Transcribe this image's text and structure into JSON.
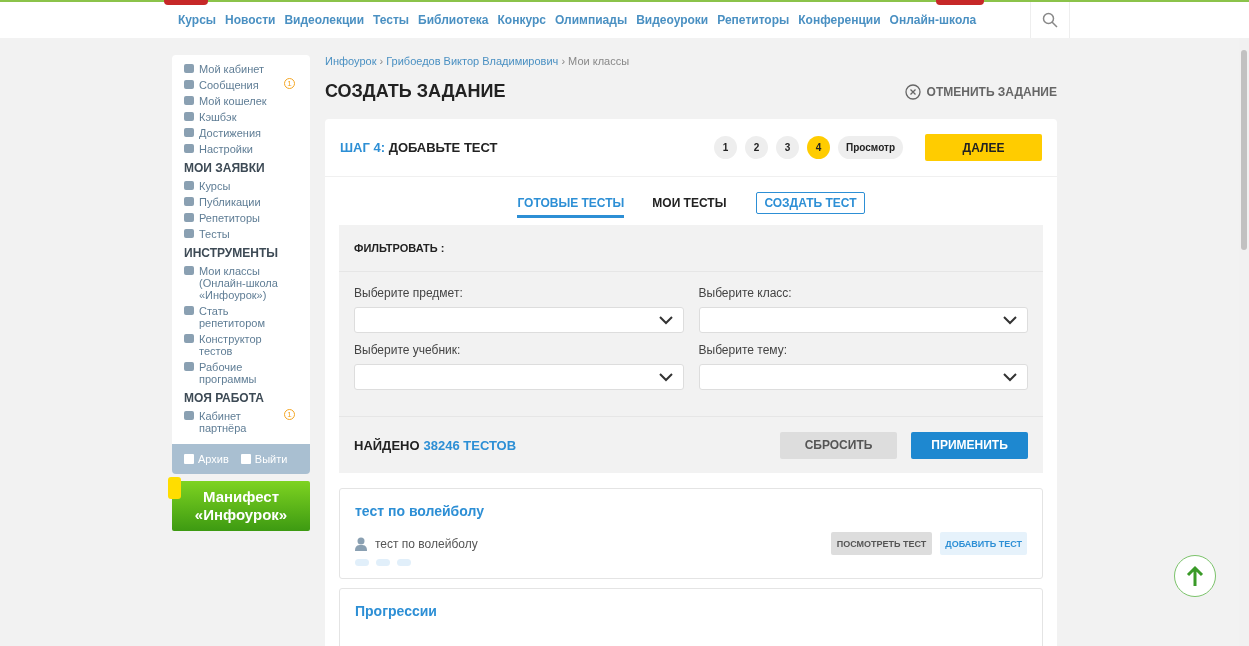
{
  "nav": {
    "items": [
      "Курсы",
      "Новости",
      "Видеолекции",
      "Тесты",
      "Библиотека",
      "Конкурс",
      "Олимпиады",
      "Видеоуроки",
      "Репетиторы",
      "Конференции",
      "Онлайн-школа"
    ]
  },
  "sidebar": {
    "sections": [
      {
        "items": [
          {
            "label": "Мой кабинет"
          },
          {
            "label": "Сообщения",
            "badge": "1"
          },
          {
            "label": "Мой кошелек"
          },
          {
            "label": "Кэшбэк"
          },
          {
            "label": "Достижения"
          },
          {
            "label": "Настройки"
          }
        ]
      },
      {
        "heading": "МОИ ЗАЯВКИ",
        "items": [
          {
            "label": "Курсы"
          },
          {
            "label": "Публикации"
          },
          {
            "label": "Репетиторы"
          },
          {
            "label": "Тесты"
          }
        ]
      },
      {
        "heading": "ИНСТРУМЕНТЫ",
        "items": [
          {
            "label": "Мои классы (Онлайн-школа «Инфоурок»)"
          },
          {
            "label": "Стать репетитором"
          },
          {
            "label": "Конструктор тестов"
          },
          {
            "label": "Рабочие программы"
          }
        ]
      },
      {
        "heading": "МОЯ РАБОТА",
        "items": [
          {
            "label": "Кабинет партнёра",
            "badge": "1"
          }
        ]
      }
    ],
    "footer": [
      "Архив",
      "Выйти"
    ],
    "promo": "Манифест «Инфоурок»"
  },
  "breadcrumbs": [
    {
      "label": "Инфоурок",
      "link": true,
      "separator": "›"
    },
    {
      "label": "Грибоедов Виктор Владимирович",
      "link": true,
      "separator": "›"
    },
    {
      "label": "Мои классы",
      "link": false
    }
  ],
  "page_title": "СОЗДАТЬ ЗАДАНИЕ",
  "cancel_label": "ОТМЕНИТЬ ЗАДАНИЕ",
  "step": {
    "prefix": "ШАГ 4:",
    "title": "ДОБАВЬТЕ ТЕСТ"
  },
  "steps": [
    {
      "label": "1",
      "selected": false
    },
    {
      "label": "2",
      "selected": false
    },
    {
      "label": "3",
      "selected": false
    },
    {
      "label": "4",
      "selected": true
    },
    {
      "label": "Просмотр",
      "selected": false
    }
  ],
  "next_button": "ДАЛЕЕ",
  "tabs": [
    {
      "label": "ГОТОВЫЕ ТЕСТЫ",
      "kind": "tab",
      "selected": true
    },
    {
      "label": "МОИ ТЕСТЫ",
      "kind": "tab",
      "selected": false
    },
    {
      "label": "СОЗДАТЬ ТЕСТ",
      "kind": "button",
      "selected": false
    }
  ],
  "filter": {
    "title": "ФИЛЬТРОВАТЬ :",
    "fields": [
      {
        "label": "Выберите предмет:"
      },
      {
        "label": "Выберите класс:"
      },
      {
        "label": "Выберите учебник:"
      },
      {
        "label": "Выберите тему:"
      }
    ],
    "found_label": "НАЙДЕНО",
    "found_count": "38246 ТЕСТОВ",
    "reset_button": "СБРОСИТЬ",
    "apply_button": "ПРИМЕНИТЬ"
  },
  "tests": [
    {
      "title": "тест по волейболу",
      "author": "тест по волейболу",
      "view_button": "ПОСМОТРЕТЬ ТЕСТ",
      "add_button": "ДОБАВИТЬ ТЕСТ"
    },
    {
      "title": "Прогрессии"
    }
  ]
}
